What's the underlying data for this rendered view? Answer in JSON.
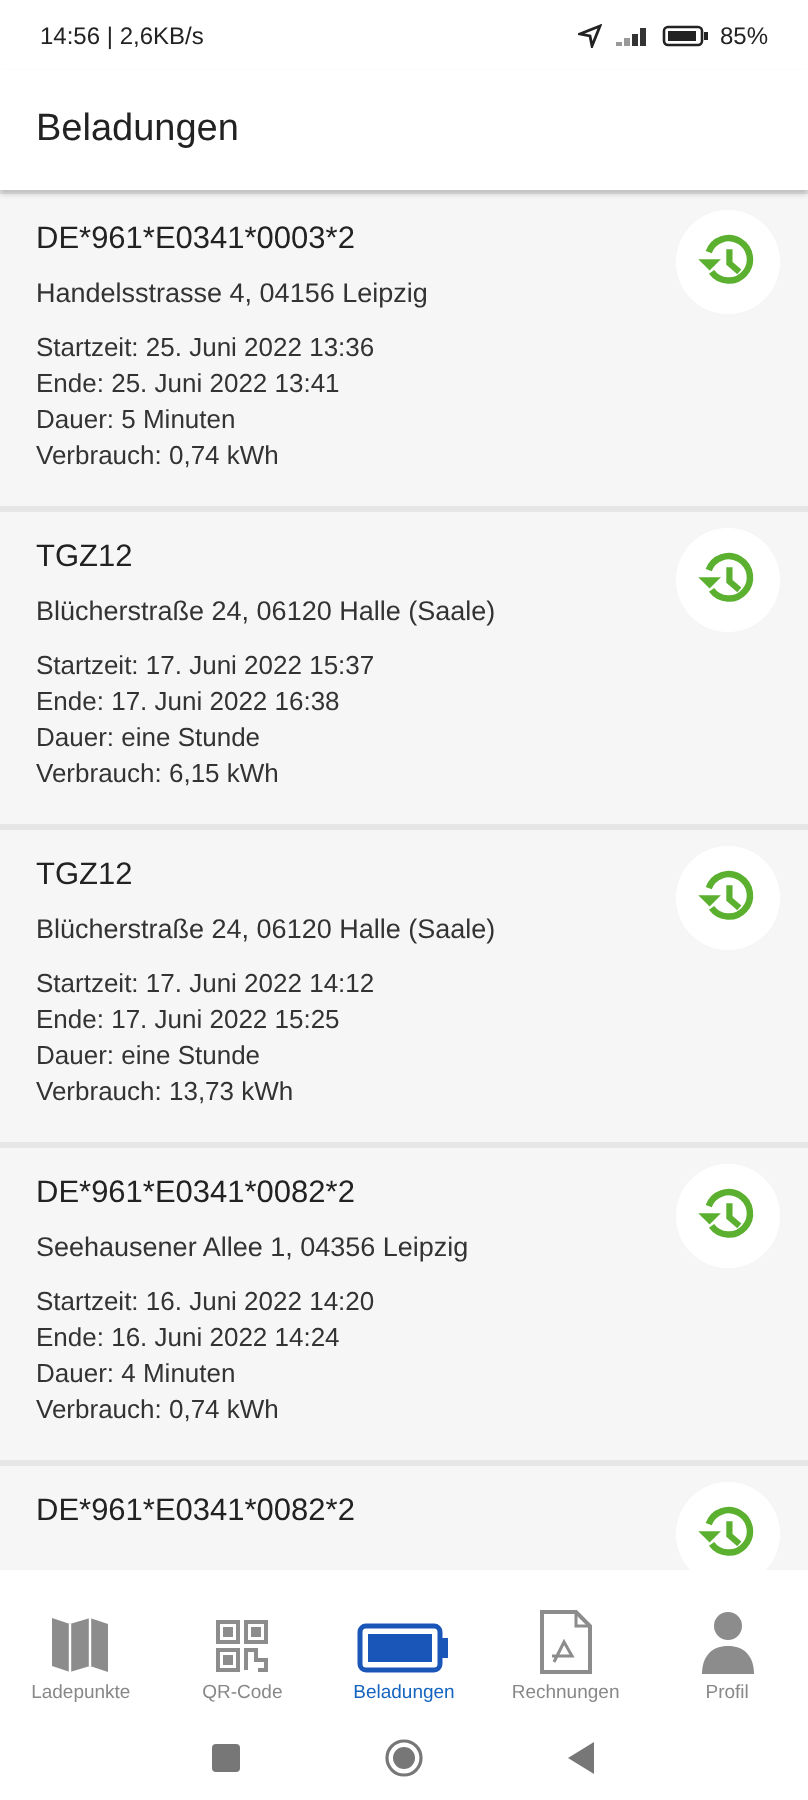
{
  "status_bar": {
    "time": "14:56 | 2,6KB/s",
    "battery": "85%"
  },
  "header": {
    "title": "Beladungen"
  },
  "charges": [
    {
      "title": "DE*961*E0341*0003*2",
      "address": "Handelsstrasse 4, 04156 Leipzig",
      "details": [
        "Startzeit: 25. Juni 2022 13:36",
        "Ende: 25. Juni 2022 13:41",
        "Dauer: 5 Minuten",
        "Verbrauch: 0,74 kWh"
      ]
    },
    {
      "title": "TGZ12",
      "address": "Blücherstraße 24, 06120 Halle (Saale)",
      "details": [
        "Startzeit: 17. Juni 2022 15:37",
        "Ende: 17. Juni 2022 16:38",
        "Dauer: eine Stunde",
        "Verbrauch: 6,15 kWh"
      ]
    },
    {
      "title": "TGZ12",
      "address": "Blücherstraße 24, 06120 Halle (Saale)",
      "details": [
        "Startzeit: 17. Juni 2022 14:12",
        "Ende: 17. Juni 2022 15:25",
        "Dauer: eine Stunde",
        "Verbrauch: 13,73 kWh"
      ]
    },
    {
      "title": "DE*961*E0341*0082*2",
      "address": "Seehausener Allee 1, 04356 Leipzig",
      "details": [
        "Startzeit: 16. Juni 2022 14:20",
        "Ende: 16. Juni 2022 14:24",
        "Dauer: 4 Minuten",
        "Verbrauch: 0,74 kWh"
      ]
    },
    {
      "title": "DE*961*E0341*0082*2"
    }
  ],
  "bottom_nav": [
    {
      "label": "Ladepunkte",
      "selected": false
    },
    {
      "label": "QR-Code",
      "selected": false
    },
    {
      "label": "Beladungen",
      "selected": true
    },
    {
      "label": "Rechnungen",
      "selected": false
    },
    {
      "label": "Profil",
      "selected": false
    }
  ]
}
